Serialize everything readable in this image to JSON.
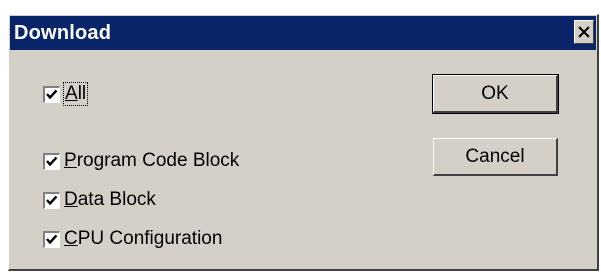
{
  "window": {
    "title": "Download",
    "close_glyph": "X"
  },
  "checkboxes": [
    {
      "id": "all",
      "label_prefix": "",
      "label_mnemonic": "A",
      "label_rest": "ll",
      "checked": true
    },
    {
      "id": "program-code-block",
      "label_prefix": "",
      "label_mnemonic": "P",
      "label_rest": "rogram Code Block",
      "checked": true
    },
    {
      "id": "data-block",
      "label_prefix": "",
      "label_mnemonic": "D",
      "label_rest": "ata Block",
      "checked": true
    },
    {
      "id": "cpu-configuration",
      "label_prefix": "",
      "label_mnemonic": "C",
      "label_rest": "PU Configuration",
      "checked": true
    }
  ],
  "buttons": {
    "ok_label": "OK",
    "cancel_label": "Cancel"
  },
  "colors": {
    "titlebar": "#0a246a",
    "face": "#d4d0c8"
  },
  "icons": {
    "close": "close-icon",
    "check": "checkmark-icon"
  }
}
